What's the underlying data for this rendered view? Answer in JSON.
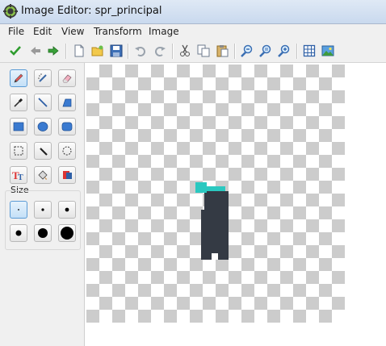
{
  "window": {
    "title": "Image Editor: spr_principal"
  },
  "menu": {
    "items": [
      "File",
      "Edit",
      "View",
      "Transform",
      "Image"
    ]
  },
  "toolbar": {
    "buttons": [
      "check-icon",
      "arrow-left-icon",
      "arrow-right-icon",
      "new-icon",
      "open-folder-icon",
      "save-icon",
      "undo-icon",
      "redo-icon",
      "cut-icon",
      "copy-icon",
      "paste-icon",
      "zoom-out-icon",
      "zoom-reset-icon",
      "zoom-in-icon",
      "grid-icon",
      "image-icon"
    ]
  },
  "tools": {
    "size_label": "Size",
    "selected_tool": "pencil",
    "selected_size": 1,
    "sizes": 6
  },
  "colors": {
    "sprite_body": "#343a44",
    "sprite_accent": "#2ac8c0",
    "checker_light": "#ffffff",
    "checker_dark": "#cccccc",
    "active_tool": "#c4e0f7"
  }
}
